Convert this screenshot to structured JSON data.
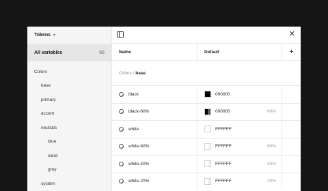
{
  "sidebar": {
    "title": "Tokens",
    "all_label": "All variables",
    "all_count": "66",
    "tree": [
      {
        "label": "Colors",
        "level": 0
      },
      {
        "label": "base",
        "level": 1
      },
      {
        "label": "primary",
        "level": 1
      },
      {
        "label": "accent",
        "level": 1
      },
      {
        "label": "neutrals",
        "level": 1
      },
      {
        "label": "blue",
        "level": 2
      },
      {
        "label": "sand",
        "level": 2
      },
      {
        "label": "grey",
        "level": 2
      },
      {
        "label": "system",
        "level": 1
      }
    ]
  },
  "table": {
    "col_name": "Name",
    "col_default": "Default",
    "add_icon": "plus-icon",
    "group_path": "Colors",
    "group_sep": " / ",
    "group_name": "base"
  },
  "rows": [
    {
      "name": "black",
      "hex": "000000",
      "alpha": "",
      "swatch": "#000000",
      "opacity": 1
    },
    {
      "name": "black-60%",
      "hex": "000000",
      "alpha": "60%",
      "swatch": "#000000",
      "opacity": 0.6
    },
    {
      "name": "white",
      "hex": "FFFFFF",
      "alpha": "",
      "swatch": "#ffffff",
      "opacity": 1
    },
    {
      "name": "white-60%",
      "hex": "FFFFFF",
      "alpha": "60%",
      "swatch": "#ffffff",
      "opacity": 0.6
    },
    {
      "name": "white-40%",
      "hex": "FFFFFF",
      "alpha": "40%",
      "swatch": "#ffffff",
      "opacity": 0.4
    },
    {
      "name": "white-20%",
      "hex": "FFFFFF",
      "alpha": "20%",
      "swatch": "#ffffff",
      "opacity": 0.2
    }
  ]
}
